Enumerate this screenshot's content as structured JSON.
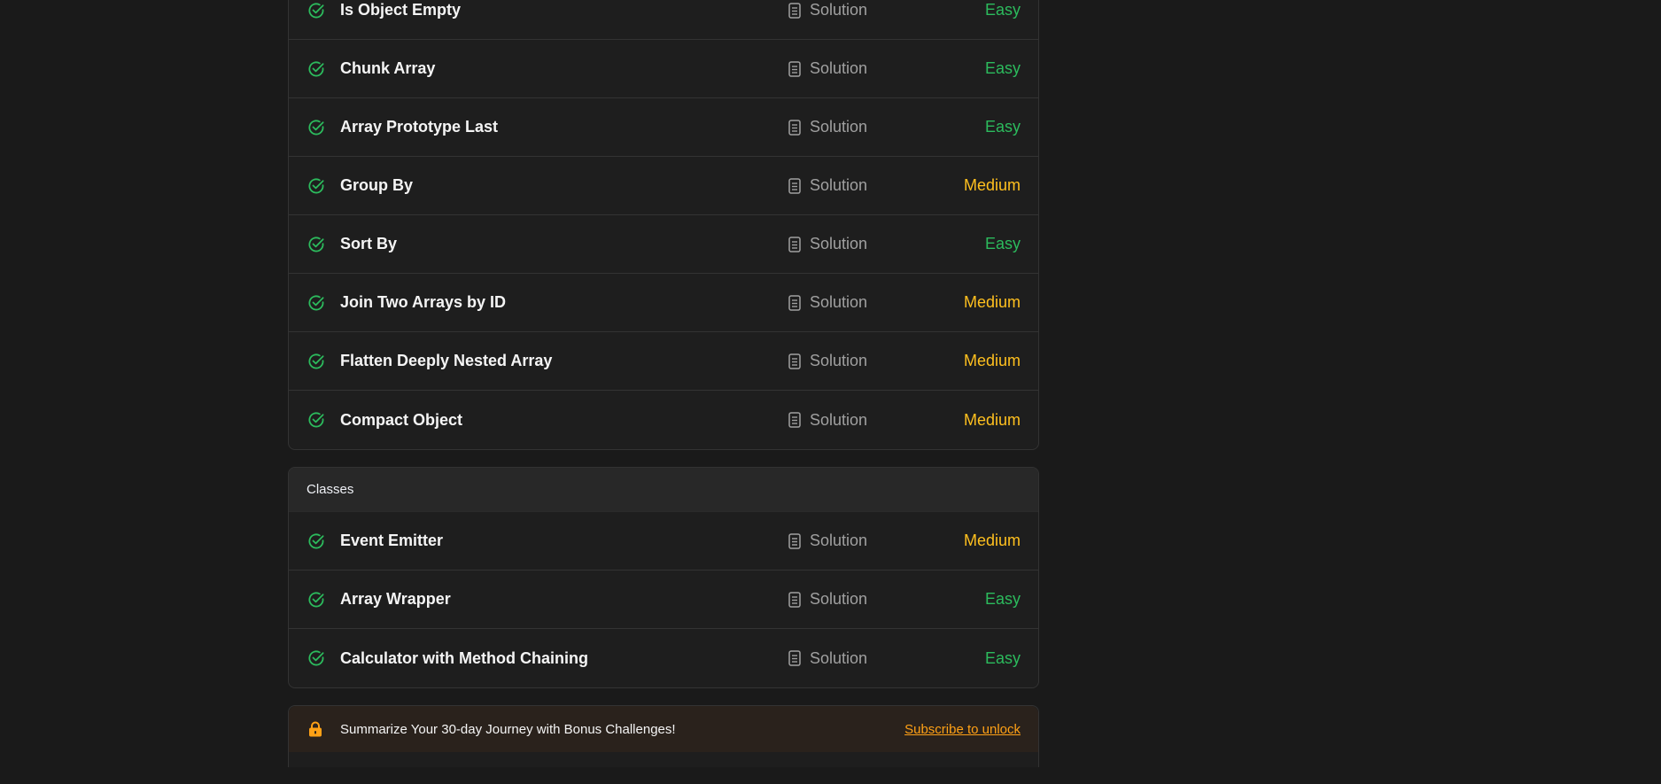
{
  "solution_label": "Solution",
  "group1": {
    "items": [
      {
        "title": "Is Object Empty",
        "difficulty": "Easy"
      },
      {
        "title": "Chunk Array",
        "difficulty": "Easy"
      },
      {
        "title": "Array Prototype Last",
        "difficulty": "Easy"
      },
      {
        "title": "Group By",
        "difficulty": "Medium"
      },
      {
        "title": "Sort By",
        "difficulty": "Easy"
      },
      {
        "title": "Join Two Arrays by ID",
        "difficulty": "Medium"
      },
      {
        "title": "Flatten Deeply Nested Array",
        "difficulty": "Medium"
      },
      {
        "title": "Compact Object",
        "difficulty": "Medium"
      }
    ]
  },
  "classes": {
    "header": "Classes",
    "items": [
      {
        "title": "Event Emitter",
        "difficulty": "Medium"
      },
      {
        "title": "Array Wrapper",
        "difficulty": "Easy"
      },
      {
        "title": "Calculator with Method Chaining",
        "difficulty": "Easy"
      }
    ]
  },
  "bonus": {
    "message": "Summarize Your 30-day Journey with Bonus Challenges!",
    "action": "Subscribe to unlock"
  },
  "colors": {
    "easy": "#2cbb5d",
    "medium": "#ffc01e",
    "accent": "#ffa116"
  }
}
